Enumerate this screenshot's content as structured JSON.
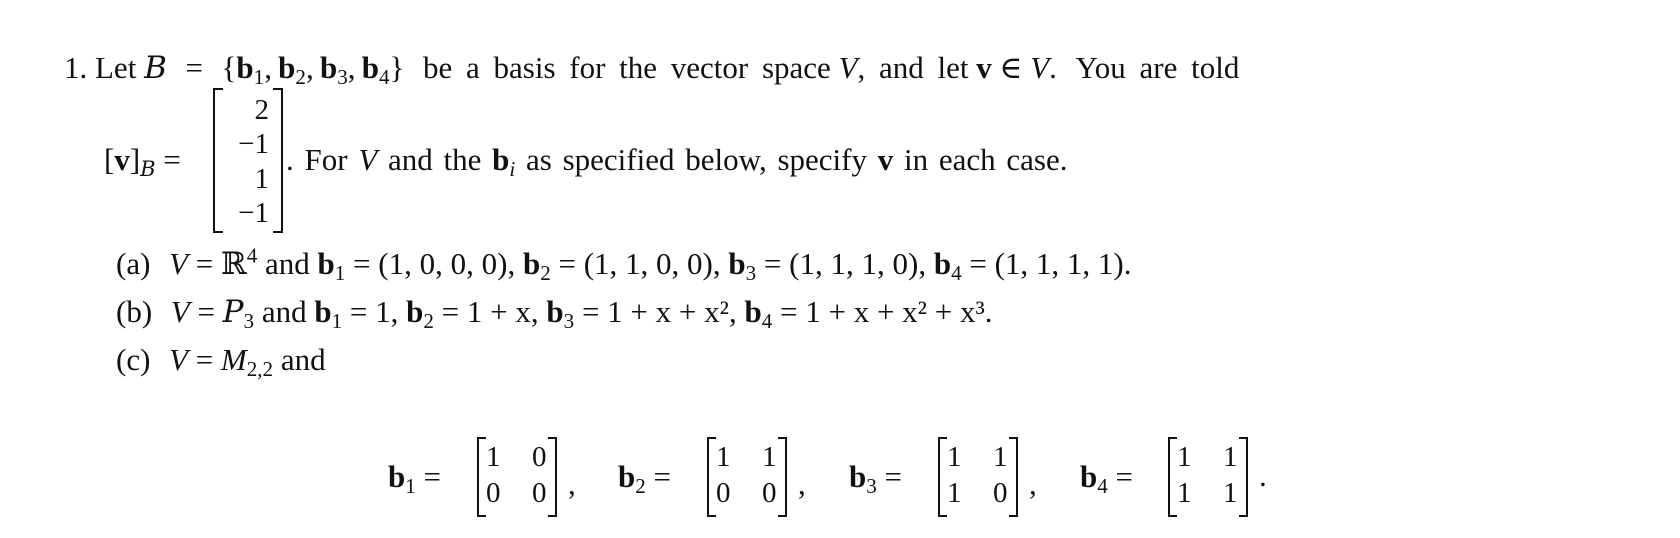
{
  "problem": {
    "number": "1.",
    "line1": {
      "let": "Let",
      "basis_symbol": "B",
      "eq": "=",
      "set_open": "{",
      "set_items": [
        "b",
        "b",
        "b",
        "b"
      ],
      "set_subs": [
        "1",
        "2",
        "3",
        "4"
      ],
      "set_close": "}",
      "text1": "be a basis for the vector space",
      "V": "V",
      "text2": ", and let",
      "v": "v",
      "in": "∈",
      "V2": "V",
      "text3": ".",
      "text4": "You are told"
    },
    "line2": {
      "lhs_open": "[",
      "lhs_v": "v",
      "lhs_close": "]",
      "lhs_sub": "B",
      "eq": "=",
      "vector": [
        "2",
        "−1",
        "1",
        "−1"
      ],
      "after": ". For",
      "V": "V",
      "and_the": "and the",
      "b": "b",
      "b_sub": "i",
      "rest1": "as specified below, specify",
      "v": "v",
      "rest2": "in each case."
    },
    "parts": [
      {
        "label": "(a)",
        "V": "V",
        "eq": "=",
        "space": "ℝ",
        "space_sup": "4",
        "and": "and",
        "basis": [
          {
            "name": "b",
            "sub": "1",
            "value": "(1, 0, 0, 0)"
          },
          {
            "name": "b",
            "sub": "2",
            "value": "(1, 1, 0, 0)"
          },
          {
            "name": "b",
            "sub": "3",
            "value": "(1, 1, 1, 0)"
          },
          {
            "name": "b",
            "sub": "4",
            "value": "(1, 1, 1, 1)"
          }
        ]
      },
      {
        "label": "(b)",
        "V": "V",
        "eq": "=",
        "space": "P",
        "space_sub": "3",
        "and": "and",
        "basis": [
          {
            "name": "b",
            "sub": "1",
            "value": "1"
          },
          {
            "name": "b",
            "sub": "2",
            "value": "1 + x"
          },
          {
            "name": "b",
            "sub": "3",
            "value": "1 + x + x²"
          },
          {
            "name": "b",
            "sub": "4",
            "value": "1 + x + x² + x³"
          }
        ]
      },
      {
        "label": "(c)",
        "V": "V",
        "eq": "=",
        "space": "M",
        "space_sub": "2,2",
        "and": "and",
        "basis": [
          {
            "name": "b",
            "sub": "1",
            "matrix": [
              [
                "1",
                "0"
              ],
              [
                "0",
                "0"
              ]
            ],
            "punct": ","
          },
          {
            "name": "b",
            "sub": "2",
            "matrix": [
              [
                "1",
                "1"
              ],
              [
                "0",
                "0"
              ]
            ],
            "punct": ","
          },
          {
            "name": "b",
            "sub": "3",
            "matrix": [
              [
                "1",
                "1"
              ],
              [
                "1",
                "0"
              ]
            ],
            "punct": ","
          },
          {
            "name": "b",
            "sub": "4",
            "matrix": [
              [
                "1",
                "1"
              ],
              [
                "1",
                "1"
              ]
            ],
            "punct": "."
          }
        ]
      }
    ]
  }
}
